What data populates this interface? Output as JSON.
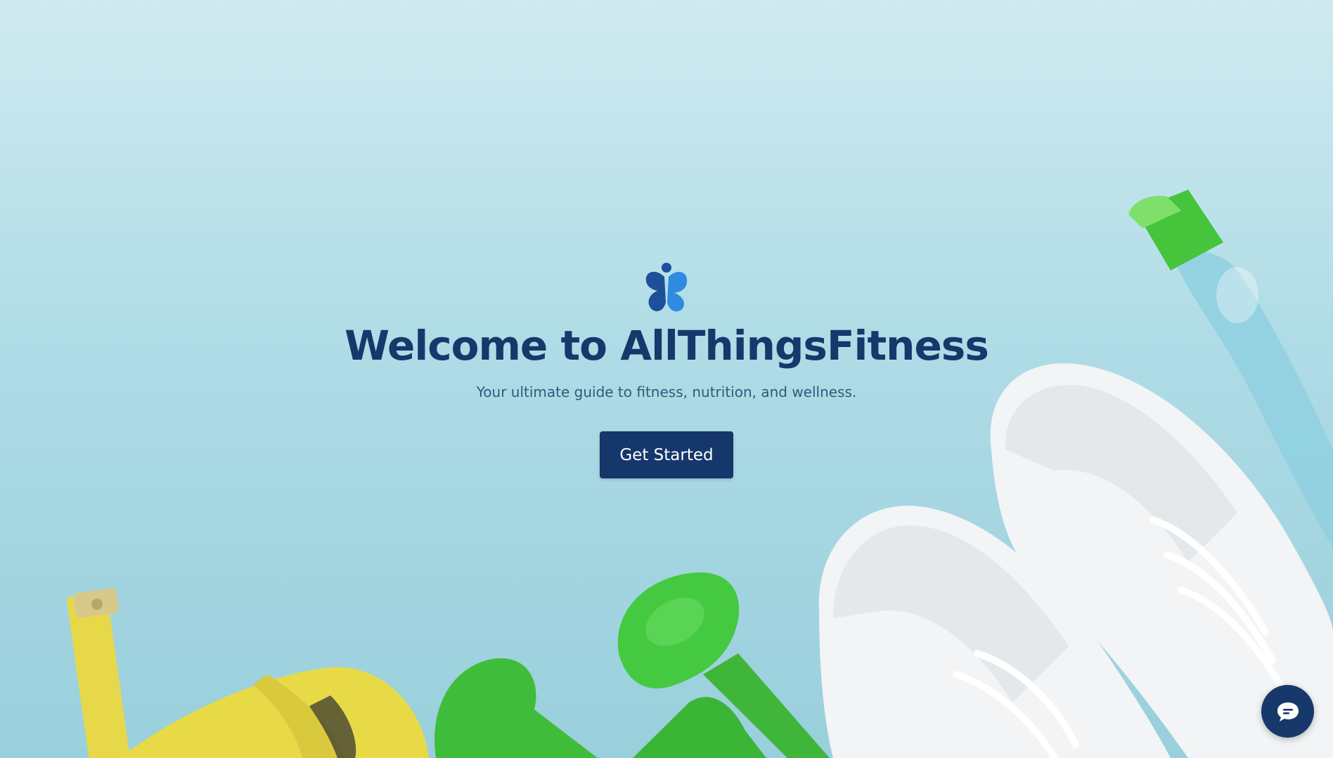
{
  "hero": {
    "title": "Welcome to AllThingsFitness",
    "subtitle": "Your ultimate guide to fitness, nutrition, and wellness.",
    "cta_label": "Get Started"
  },
  "logo": {
    "icon": "butterfly-person-logo-icon"
  },
  "chat": {
    "icon": "chat-bubble-icon"
  },
  "background": {
    "objects": [
      "measuring-tape",
      "green-dumbbells",
      "white-sneakers",
      "water-bottle"
    ]
  },
  "colors": {
    "background": "#afdce6",
    "title": "#17386b",
    "subtitle": "#35587a",
    "button": "#15376b",
    "logo_dark": "#1e4f9a",
    "logo_light": "#2f8ae0"
  }
}
